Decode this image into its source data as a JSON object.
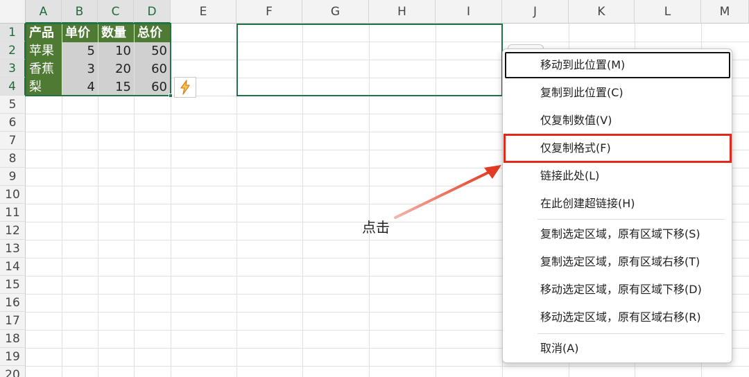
{
  "columns": [
    "A",
    "B",
    "C",
    "D",
    "E",
    "F",
    "G",
    "H",
    "I",
    "J",
    "K",
    "L",
    "M"
  ],
  "rows": [
    "1",
    "2",
    "3",
    "4",
    "5",
    "6",
    "7",
    "8",
    "9",
    "10",
    "11",
    "12",
    "13",
    "14",
    "15",
    "16",
    "17",
    "18",
    "19",
    "20"
  ],
  "table": {
    "headers": [
      "产品",
      "单价",
      "数量",
      "总价"
    ],
    "rows": [
      [
        "苹果",
        "5",
        "10",
        "50"
      ],
      [
        "香蕉",
        "3",
        "20",
        "60"
      ],
      [
        "梨",
        "4",
        "15",
        "60"
      ]
    ]
  },
  "colors": {
    "header_green": "#4e7a34",
    "selection_green": "#217346",
    "highlight_red": "#e0281b"
  },
  "quick_analysis_icon": "lightning-icon",
  "annotation": {
    "text": "点击"
  },
  "context_menu": {
    "items": [
      {
        "label": "移动到此位置(M)",
        "state": "focused"
      },
      {
        "label": "复制到此位置(C)"
      },
      {
        "label": "仅复制数值(V)"
      },
      {
        "label": "仅复制格式(F)",
        "state": "highlighted"
      },
      {
        "label": "链接此处(L)"
      },
      {
        "label": "在此创建超链接(H)"
      },
      {
        "label": "复制选定区域，原有区域下移(S)"
      },
      {
        "label": "复制选定区域，原有区域右移(T)"
      },
      {
        "label": "移动选定区域，原有区域下移(D)"
      },
      {
        "label": "移动选定区域，原有区域右移(R)"
      },
      {
        "label": "取消(A)"
      }
    ]
  }
}
